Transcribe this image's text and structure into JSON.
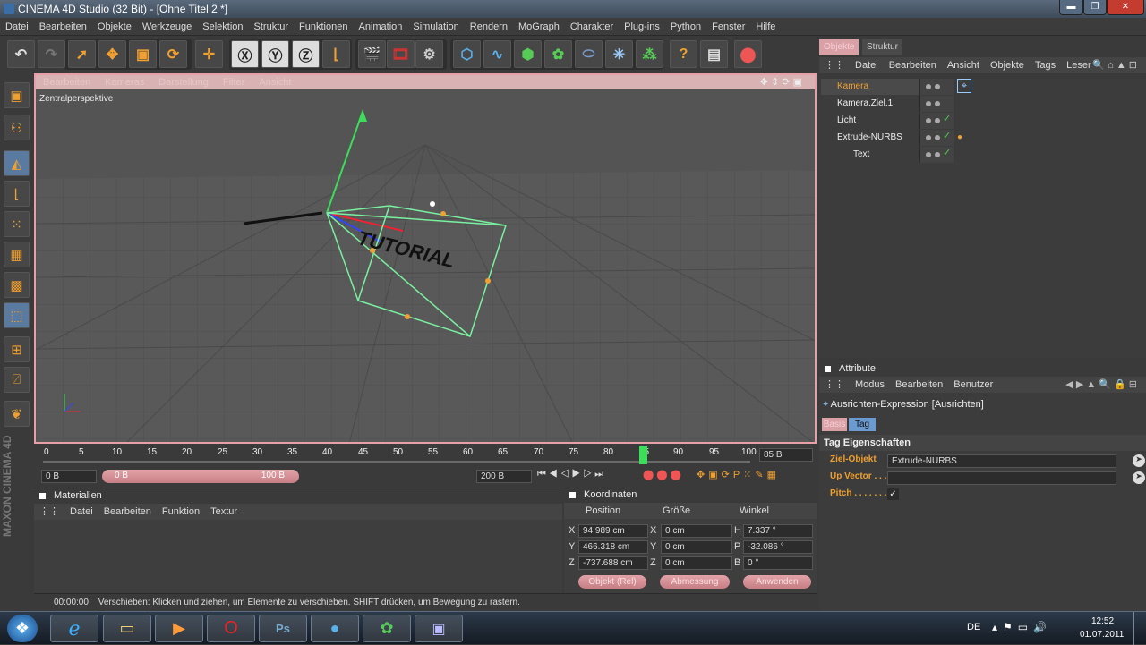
{
  "window": {
    "title": "CINEMA 4D Studio (32 Bit) - [Ohne Titel 2 *]"
  },
  "menu": [
    "Datei",
    "Bearbeiten",
    "Objekte",
    "Werkzeuge",
    "Selektion",
    "Struktur",
    "Funktionen",
    "Animation",
    "Simulation",
    "Rendern",
    "MoGraph",
    "Charakter",
    "Plug-ins",
    "Python",
    "Fenster",
    "Hilfe"
  ],
  "viewport": {
    "menu": [
      "Bearbeiten",
      "Kameras",
      "Darstellung",
      "Filter",
      "Ansicht"
    ],
    "label": "Zentralperspektive",
    "text_object": "TUTORIAL"
  },
  "timeline": {
    "ticks": [
      "0",
      "5",
      "10",
      "15",
      "20",
      "25",
      "30",
      "35",
      "40",
      "45",
      "50",
      "55",
      "60",
      "65",
      "70",
      "75",
      "80",
      "85",
      "90",
      "95",
      "100"
    ],
    "current_frame": "85 B",
    "start_field": "0 B",
    "range_start": "0 B",
    "range_end": "100 B",
    "end_field": "200 B"
  },
  "materials": {
    "title": "Materialien",
    "menu": [
      "Datei",
      "Bearbeiten",
      "Funktion",
      "Textur"
    ]
  },
  "coords": {
    "title": "Koordinaten",
    "headers": [
      "Position",
      "Größe",
      "Winkel"
    ],
    "rows": [
      {
        "axis": "X",
        "pos": "94.989 cm",
        "size_axis": "X",
        "size": "0 cm",
        "ang_axis": "H",
        "ang": "7.337 °"
      },
      {
        "axis": "Y",
        "pos": "466.318 cm",
        "size_axis": "Y",
        "size": "0 cm",
        "ang_axis": "P",
        "ang": "-32.086 °"
      },
      {
        "axis": "Z",
        "pos": "-737.688 cm",
        "size_axis": "Z",
        "size": "0 cm",
        "ang_axis": "B",
        "ang": "0 °"
      }
    ],
    "buttons": [
      "Objekt (Rel)",
      "Abmessung",
      "Anwenden"
    ]
  },
  "status": {
    "time": "00:00:00",
    "text": "Verschieben: Klicken und ziehen, um Elemente zu verschieben. SHIFT drücken, um Bewegung zu rastern."
  },
  "objects": {
    "tabs": [
      "Objekte",
      "Struktur"
    ],
    "menu": [
      "Datei",
      "Bearbeiten",
      "Ansicht",
      "Objekte",
      "Tags",
      "Leser"
    ],
    "items": [
      {
        "name": "Kamera",
        "color": "#f0a030"
      },
      {
        "name": "Kamera.Ziel.1",
        "color": "#eeeeee"
      },
      {
        "name": "Licht",
        "color": "#eeeeee"
      },
      {
        "name": "Extrude-NURBS",
        "color": "#eeeeee"
      },
      {
        "name": "Text",
        "color": "#eeeeee"
      }
    ]
  },
  "attributes": {
    "title": "Attribute",
    "menu": [
      "Modus",
      "Bearbeiten",
      "Benutzer"
    ],
    "object": "Ausrichten-Expression [Ausrichten]",
    "tabs": [
      "Basis",
      "Tag"
    ],
    "section": "Tag Eigenschaften",
    "fields": [
      {
        "label": "Ziel-Objekt",
        "value": "Extrude-NURBS"
      },
      {
        "label": "Up Vector . . . .",
        "value": ""
      },
      {
        "label": "Pitch . . . . . . .",
        "value": "✓"
      }
    ]
  },
  "taskbar": {
    "lang": "DE",
    "time": "12:52",
    "date": "01.07.2011"
  }
}
